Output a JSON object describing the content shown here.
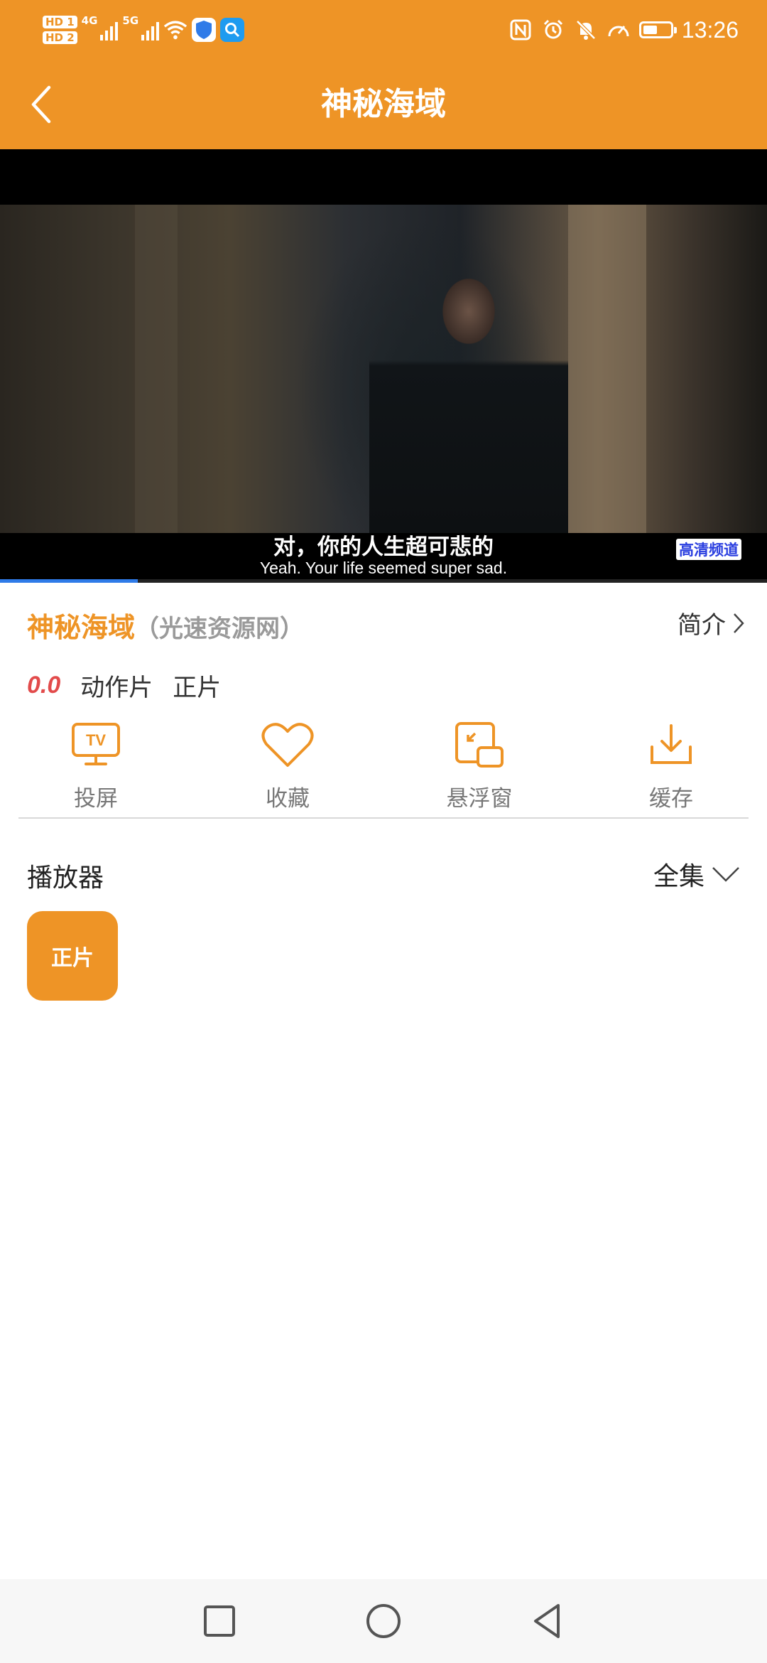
{
  "status_bar": {
    "hd1": "HD 1",
    "hd2": "HD 2",
    "net1": "4G",
    "net2": "5G",
    "time": "13:26",
    "battery_level": 0.6
  },
  "header": {
    "title": "神秘海域"
  },
  "video": {
    "subtitle_zh": "对，你的人生超可悲的",
    "subtitle_en": "Yeah. Your life seemed super sad.",
    "watermark": "高清频道",
    "progress": 0.18
  },
  "info": {
    "title": "神秘海域",
    "source": "（光速资源网）",
    "intro_label": "简介",
    "rating": "0.0",
    "genre": "动作片",
    "type": "正片"
  },
  "actions": [
    {
      "label": "投屏",
      "icon": "tv-icon"
    },
    {
      "label": "收藏",
      "icon": "heart-icon"
    },
    {
      "label": "悬浮窗",
      "icon": "pip-icon"
    },
    {
      "label": "缓存",
      "icon": "download-icon"
    }
  ],
  "player": {
    "label": "播放器",
    "episodes_label": "全集",
    "episodes": [
      "正片"
    ]
  },
  "colors": {
    "accent": "#ee9426",
    "rating": "#e24b4b",
    "progress": "#2f7be8"
  }
}
